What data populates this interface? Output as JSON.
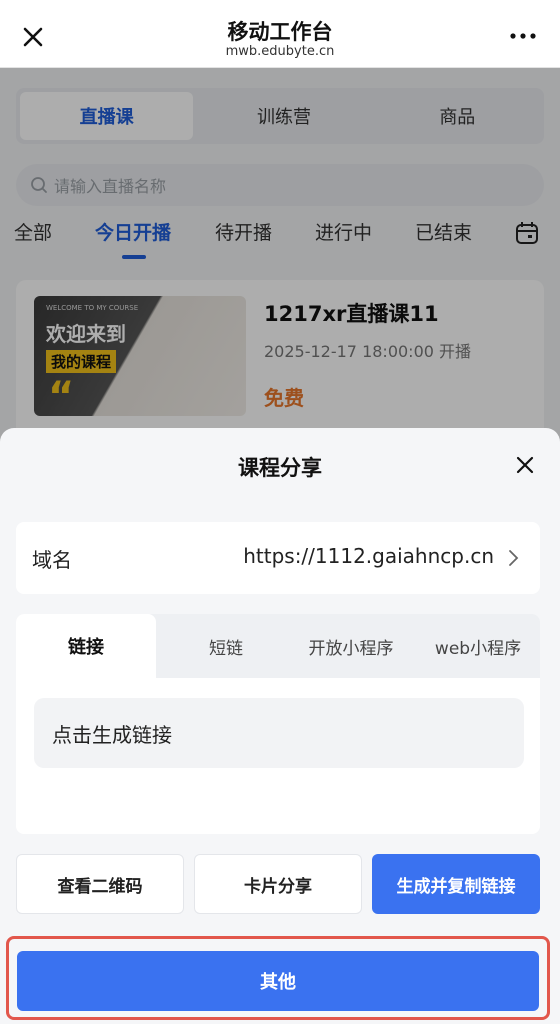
{
  "header": {
    "title": "移动工作台",
    "subtitle": "mwb.edubyte.cn"
  },
  "background": {
    "segments": [
      "直播课",
      "训练营",
      "商品"
    ],
    "active_segment": "直播课",
    "search_placeholder": "请输入直播名称",
    "status_tabs": [
      "全部",
      "今日开播",
      "待开播",
      "进行中",
      "已结束"
    ],
    "active_status_tab": "今日开播",
    "course": {
      "thumb_small": "WELCOME TO MY COURSE",
      "thumb_line1": "欢迎来到",
      "thumb_line2": "我的课程",
      "thumb_quote": "“",
      "title": "1217xr直播课11",
      "datetime": "2025-12-17 18:00:00 开播",
      "price": "免费"
    }
  },
  "sheet": {
    "title": "课程分享",
    "domain_label": "域名",
    "domain_value": "https://1112.gaiahncp.cn",
    "tabs": [
      "链接",
      "短链",
      "开放小程序",
      "web小程序"
    ],
    "active_tab": "链接",
    "link_placeholder": "点击生成链接",
    "buttons": {
      "qrcode": "查看二维码",
      "card_share": "卡片分享",
      "generate_copy": "生成并复制链接",
      "other": "其他"
    }
  },
  "colors": {
    "primary": "#3a72f0",
    "accent_tab": "#1f5ed9",
    "price": "#e7762b",
    "highlight_border": "#e2574c"
  }
}
